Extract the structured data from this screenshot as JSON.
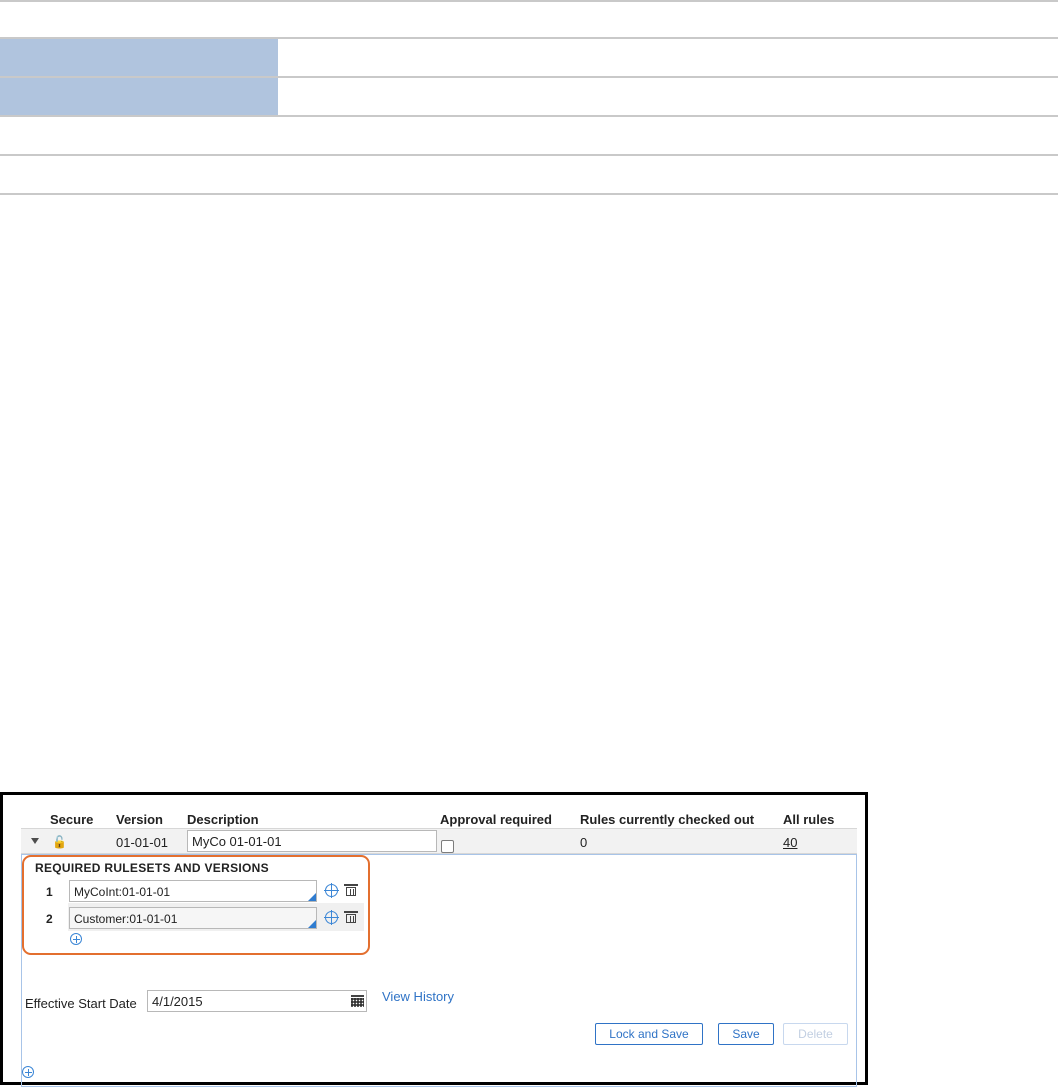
{
  "top_band": {
    "rows": [
      {
        "highlighted": true
      },
      {
        "highlighted": true
      },
      {
        "highlighted": false
      },
      {
        "highlighted": false
      }
    ]
  },
  "table": {
    "headers": {
      "secure": "Secure",
      "version": "Version",
      "description": "Description",
      "approval_required": "Approval required",
      "rules_checked_out": "Rules currently checked out",
      "all_rules": "All rules"
    },
    "row": {
      "secure_icon": "lock-open-icon",
      "version": "01-01-01",
      "description": "MyCo 01-01-01",
      "approval_required_checked": false,
      "rules_checked_out": "0",
      "all_rules": "40"
    }
  },
  "required_rulesets": {
    "title": "REQUIRED RULESETS AND VERSIONS",
    "items": [
      {
        "index": "1",
        "value": "MyCoInt:01-01-01"
      },
      {
        "index": "2",
        "value": "Customer:01-01-01"
      }
    ]
  },
  "effective_start_date": {
    "label": "Effective Start Date",
    "value": "4/1/2015"
  },
  "view_history_label": "View History",
  "buttons": {
    "lock_and_save": "Lock and Save",
    "save": "Save",
    "delete": "Delete"
  },
  "colors": {
    "highlight": "#b0c4de",
    "accent": "#2f73c6",
    "callout": "#e36f2f"
  }
}
